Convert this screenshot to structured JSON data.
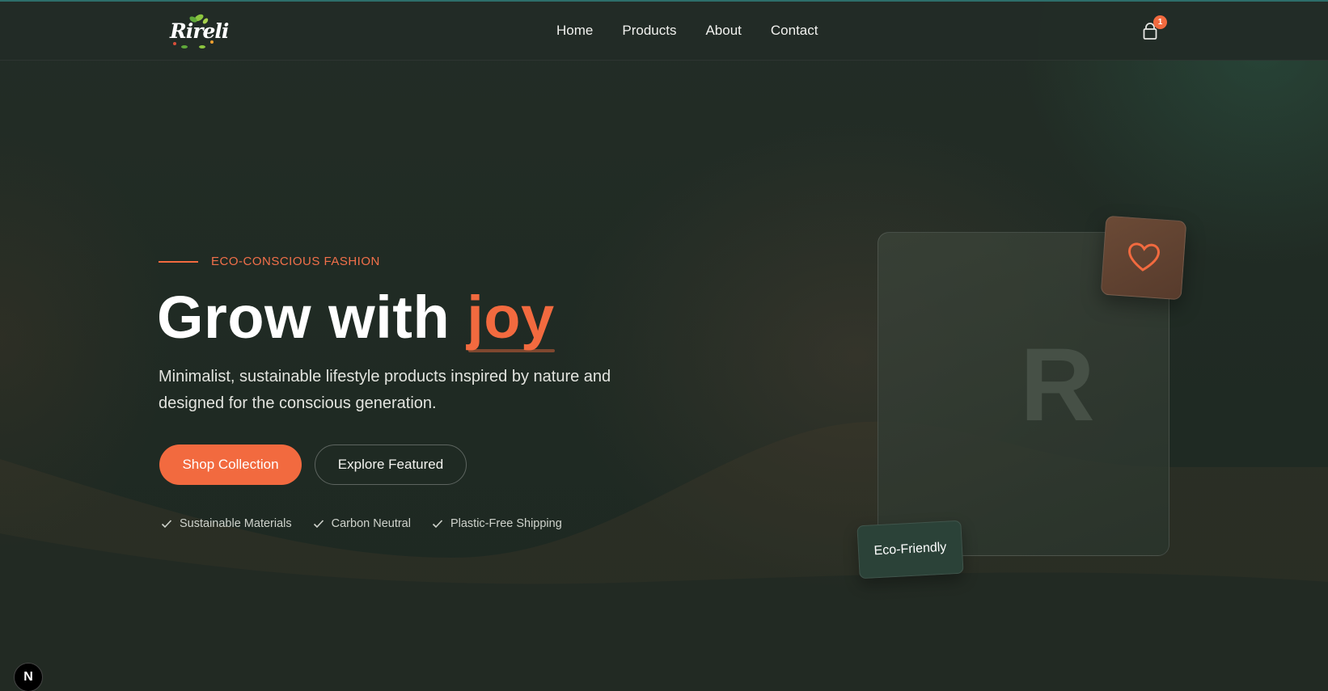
{
  "header": {
    "logo_text": "Rireli",
    "nav": [
      {
        "label": "Home"
      },
      {
        "label": "Products"
      },
      {
        "label": "About"
      },
      {
        "label": "Contact"
      }
    ],
    "cart_icon": "shopping-bag-icon",
    "cart_count": "1"
  },
  "hero": {
    "eyebrow": "ECO-CONSCIOUS FASHION",
    "title_main": "Grow with ",
    "title_accent": "joy",
    "description": "Minimalist, sustainable lifestyle products inspired by nature and designed for the conscious generation.",
    "primary_button": "Shop Collection",
    "secondary_button": "Explore Featured",
    "features": [
      {
        "label": "Sustainable Materials",
        "icon": "check-icon"
      },
      {
        "label": "Carbon Neutral",
        "icon": "check-icon"
      },
      {
        "label": "Plastic-Free Shipping",
        "icon": "check-icon"
      }
    ]
  },
  "showcase": {
    "card_letter": "R",
    "heart_icon": "heart-icon",
    "badge": "Eco-Friendly"
  },
  "dev_badge": "N",
  "colors": {
    "accent": "#f26a3f",
    "background": "#1f2a22",
    "badge_green": "#2b4238",
    "heart_tile": "#6b4a36"
  }
}
